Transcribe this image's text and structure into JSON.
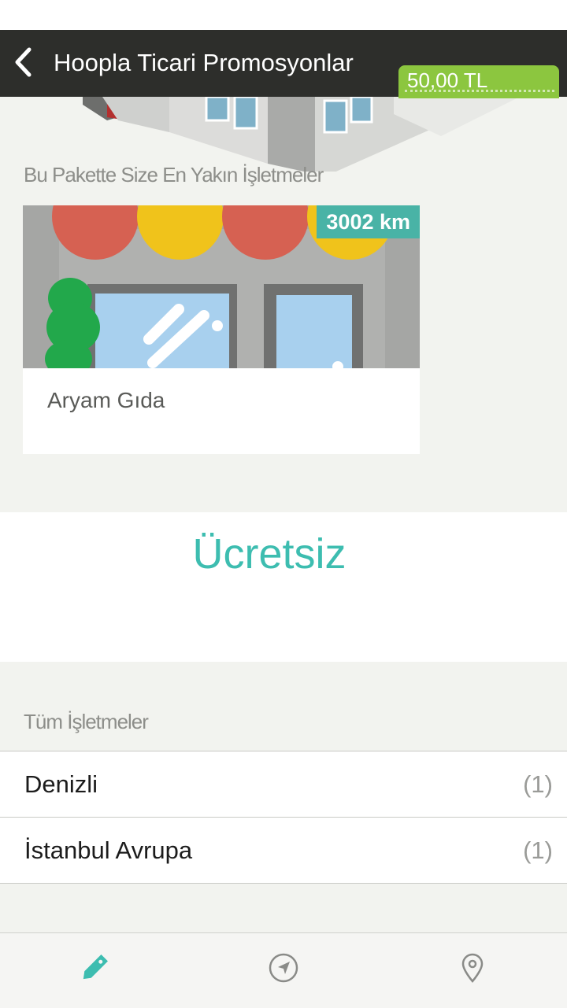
{
  "header": {
    "title": "Hoopla Ticari Promosyonlar",
    "price": "50,00 TL"
  },
  "nearby": {
    "section_title": "Bu Pakette Size En Yakın İşletmeler",
    "cards": [
      {
        "name": "Aryam Gıda",
        "distance": "3002 km"
      }
    ]
  },
  "price_panel": {
    "label": "Ücretsiz"
  },
  "all_businesses": {
    "section_title": "Tüm İşletmeler",
    "items": [
      {
        "name": "Denizli",
        "count": "(1)"
      },
      {
        "name": "İstanbul Avrupa",
        "count": "(1)"
      }
    ]
  },
  "tabbar": {
    "tabs": [
      {
        "icon": "tag-icon",
        "active": true
      },
      {
        "icon": "navigation-arrow-icon",
        "active": false
      },
      {
        "icon": "map-pin-icon",
        "active": false
      }
    ]
  },
  "colors": {
    "nav_background": "#2d2e2b",
    "price_badge": "#8cc63f",
    "accent_teal": "#3dbdb0",
    "distance_badge": "#49b3a6"
  }
}
